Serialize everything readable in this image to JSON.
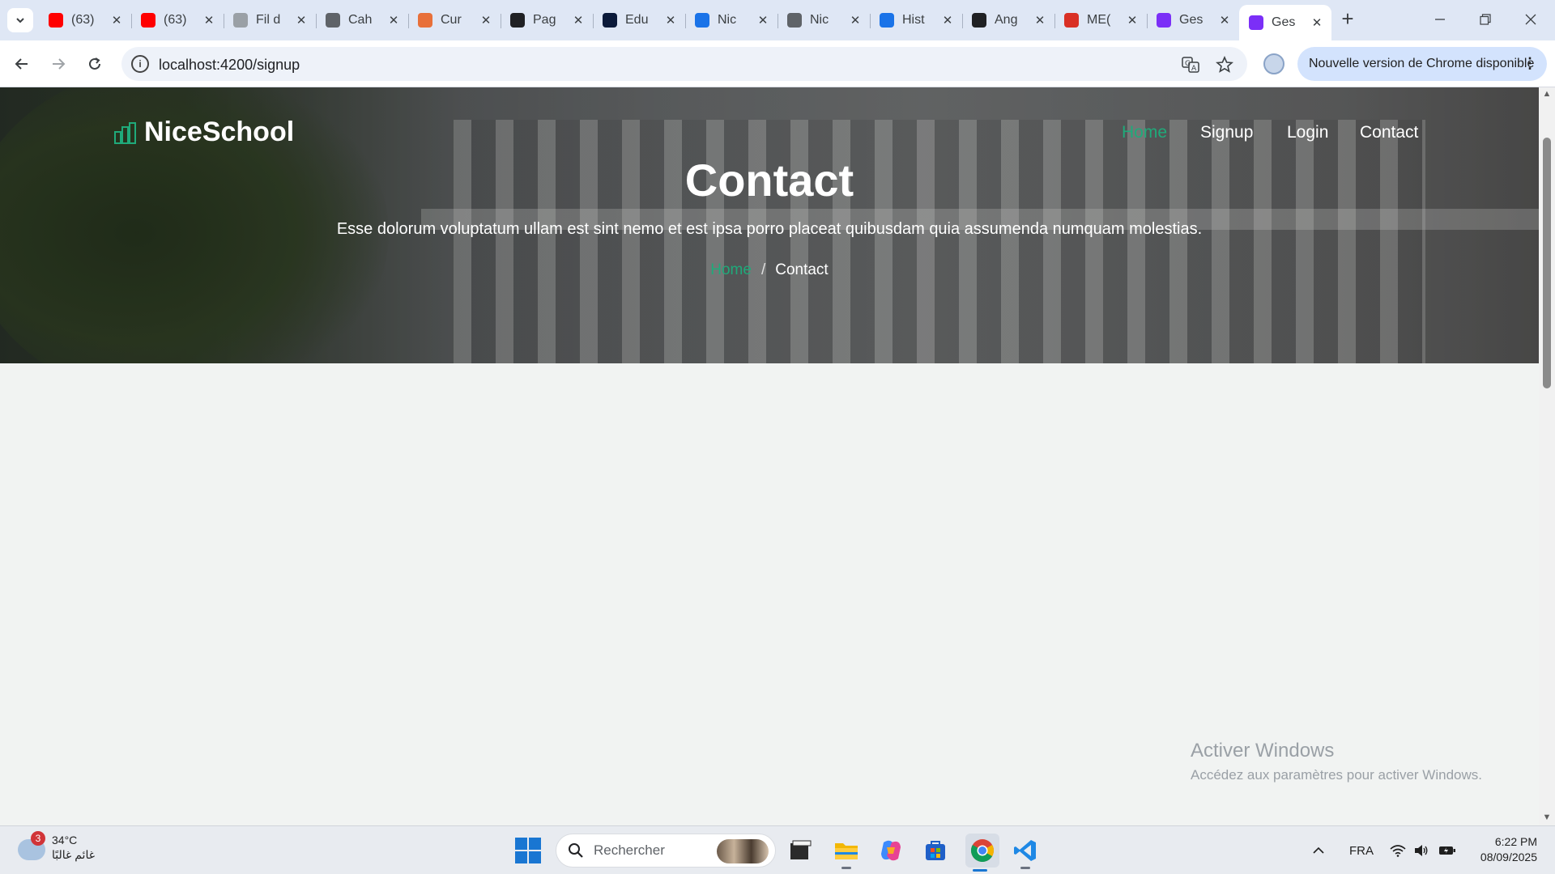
{
  "browser": {
    "tabs": [
      {
        "label": "(63)",
        "favicon": "youtube-icon",
        "color": "#ff0000"
      },
      {
        "label": "(63)",
        "favicon": "youtube-icon",
        "color": "#ff0000"
      },
      {
        "label": "Fil d",
        "favicon": "document-icon",
        "color": "#9aa0a6"
      },
      {
        "label": "Cah",
        "favicon": "globe-icon",
        "color": "#5f6368"
      },
      {
        "label": "Cur",
        "favicon": "cloud-icon",
        "color": "#e8703a"
      },
      {
        "label": "Pag",
        "favicon": "chatgpt-icon",
        "color": "#202124"
      },
      {
        "label": "Edu",
        "favicon": "y-logo-icon",
        "color": "#0b1a3a"
      },
      {
        "label": "Nic",
        "favicon": "n-logo-icon",
        "color": "#1a73e8"
      },
      {
        "label": "Nic",
        "favicon": "globe-icon",
        "color": "#5f6368"
      },
      {
        "label": "Hist",
        "favicon": "download-icon",
        "color": "#1a73e8"
      },
      {
        "label": "Ang",
        "favicon": "chatgpt-icon",
        "color": "#202124"
      },
      {
        "label": "ME(",
        "favicon": "m-logo-icon",
        "color": "#d93025"
      },
      {
        "label": "Ges",
        "favicon": "bootstrap-icon",
        "color": "#7b2ff7"
      },
      {
        "label": "Ges",
        "favicon": "bootstrap-icon",
        "color": "#7b2ff7",
        "active": true
      }
    ],
    "url": "localhost:4200/signup",
    "update_notice": "Nouvelle version de Chrome disponible"
  },
  "site": {
    "brand": "NiceSchool",
    "nav": [
      {
        "label": "Home",
        "active": true
      },
      {
        "label": "Signup"
      },
      {
        "label": "Login"
      },
      {
        "label": "Contact"
      }
    ],
    "hero": {
      "title": "Contact",
      "subtitle": "Esse dolorum voluptatum ullam est sint nemo et est ipsa porro placeat quibusdam quia assumenda numquam molestias.",
      "breadcrumb": {
        "home": "Home",
        "separator": "/",
        "current": "Contact"
      }
    },
    "accent_color": "#1faa7a"
  },
  "watermark": {
    "line1": "Activer Windows",
    "line2": "Accédez aux paramètres pour activer Windows."
  },
  "taskbar": {
    "weather": {
      "temp": "34°C",
      "condition": "غائم غالبًا",
      "badge": "3"
    },
    "search_placeholder": "Rechercher",
    "apps": [
      "file-explorer-icon",
      "folder-icon",
      "copilot-icon",
      "store-icon",
      "chrome-icon",
      "vscode-icon"
    ],
    "language": "FRA",
    "time": "6:22 PM",
    "date": "08/09/2025"
  }
}
